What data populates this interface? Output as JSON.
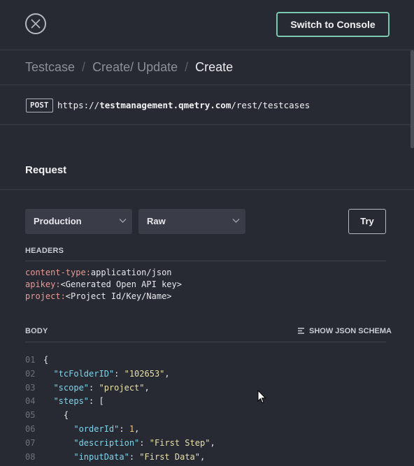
{
  "header": {
    "switch_console_label": "Switch to Console"
  },
  "breadcrumb": {
    "items": [
      "Testcase",
      "Create/ Update"
    ],
    "current": "Create",
    "separator": "/"
  },
  "endpoint": {
    "method": "POST",
    "url_prefix": "https://",
    "url_host": "testmanagement.qmetry.com",
    "url_path": "/rest/testcases"
  },
  "request": {
    "title": "Request",
    "environment": "Production",
    "format": "Raw",
    "try_label": "Try"
  },
  "headers": {
    "label": "HEADERS",
    "items": [
      {
        "key": "content-type:",
        "value": "application/json"
      },
      {
        "key": "apikey:",
        "value": "<Generated Open API key>"
      },
      {
        "key": "project:",
        "value": "<Project Id/Key/Name>"
      }
    ]
  },
  "body": {
    "label": "BODY",
    "schema_link": "SHOW JSON SCHEMA",
    "lines": [
      {
        "n": "01",
        "indent": "",
        "key": "",
        "value": "",
        "type": "",
        "text": "{",
        "trail": ""
      },
      {
        "n": "02",
        "indent": "  ",
        "key": "\"tcFolderID\"",
        "value": "\"102653\"",
        "type": "str",
        "text": "",
        "trail": ","
      },
      {
        "n": "03",
        "indent": "  ",
        "key": "\"scope\"",
        "value": "\"project\"",
        "type": "str",
        "text": "",
        "trail": ","
      },
      {
        "n": "04",
        "indent": "  ",
        "key": "\"steps\"",
        "value": "",
        "type": "",
        "text": "[",
        "trail": ""
      },
      {
        "n": "05",
        "indent": "    ",
        "key": "",
        "value": "",
        "type": "",
        "text": "{",
        "trail": ""
      },
      {
        "n": "06",
        "indent": "      ",
        "key": "\"orderId\"",
        "value": "1",
        "type": "num",
        "text": "",
        "trail": ","
      },
      {
        "n": "07",
        "indent": "      ",
        "key": "\"description\"",
        "value": "\"First Step\"",
        "type": "str",
        "text": "",
        "trail": ","
      },
      {
        "n": "08",
        "indent": "      ",
        "key": "\"inputData\"",
        "value": "\"First Data\"",
        "type": "str",
        "text": "",
        "trail": ","
      }
    ]
  },
  "colors": {
    "background": "#272a33",
    "accent_border": "#7ac8b0",
    "header_key": "#e79a93",
    "json_key": "#7fd4ea",
    "json_string": "#e7e0a8",
    "json_number": "#eec179"
  },
  "icons": {
    "close": "close-icon",
    "select_chevron": "chevron-down-icon",
    "schema": "list-icon"
  }
}
